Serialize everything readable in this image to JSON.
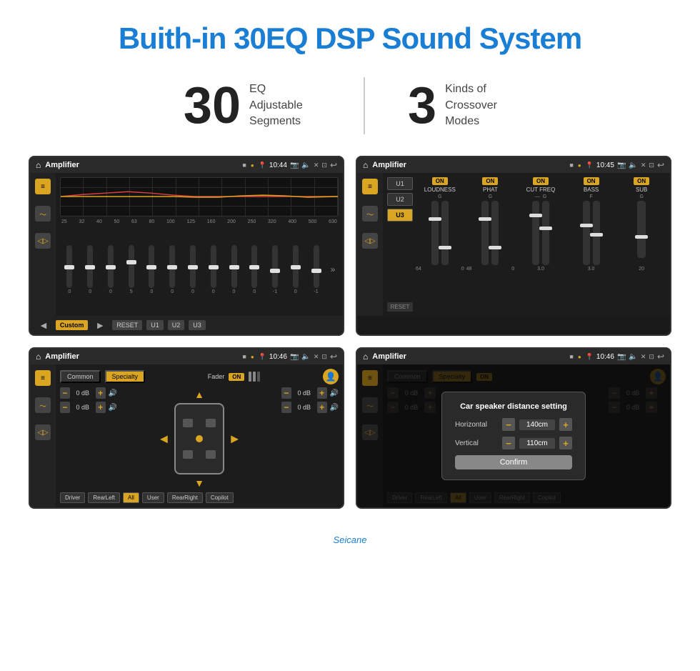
{
  "page": {
    "title": "Buith-in 30EQ DSP Sound System",
    "stat1_number": "30",
    "stat1_desc": "EQ Adjustable\nSegments",
    "stat2_number": "3",
    "stat2_desc": "Kinds of\nCrossover Modes",
    "watermark": "Seicane"
  },
  "screen1": {
    "time": "10:44",
    "title": "Amplifier",
    "freq_labels": [
      "25",
      "32",
      "40",
      "50",
      "63",
      "80",
      "100",
      "125",
      "160",
      "200",
      "250",
      "320",
      "400",
      "500",
      "630"
    ],
    "slider_values": [
      "0",
      "0",
      "0",
      "5",
      "0",
      "0",
      "0",
      "0",
      "0",
      "0",
      "-1",
      "0",
      "-1"
    ],
    "preset_label": "Custom",
    "buttons": [
      "RESET",
      "U1",
      "U2",
      "U3"
    ]
  },
  "screen2": {
    "time": "10:45",
    "title": "Amplifier",
    "presets": [
      "U1",
      "U2",
      "U3"
    ],
    "active_preset": "U3",
    "bands": [
      {
        "name": "LOUDNESS",
        "toggle": "ON",
        "label": "G"
      },
      {
        "name": "PHAT",
        "toggle": "ON",
        "label": "G"
      },
      {
        "name": "CUT FREQ",
        "toggle": "ON",
        "label": "F"
      },
      {
        "name": "BASS",
        "toggle": "ON",
        "label": "F"
      },
      {
        "name": "SUB",
        "toggle": "ON",
        "label": "G"
      }
    ],
    "reset_label": "RESET"
  },
  "screen3": {
    "time": "10:46",
    "title": "Amplifier",
    "tabs": [
      "Common",
      "Specialty"
    ],
    "active_tab": "Specialty",
    "fader_label": "Fader",
    "fader_toggle": "ON",
    "channels": [
      {
        "label": "0 dB"
      },
      {
        "label": "0 dB"
      },
      {
        "label": "0 dB"
      },
      {
        "label": "0 dB"
      }
    ],
    "bottom_btns": [
      "Driver",
      "RearLeft",
      "All",
      "User",
      "RearRight",
      "Copilot"
    ]
  },
  "screen4": {
    "time": "10:46",
    "title": "Amplifier",
    "tabs": [
      "Common",
      "Specialty"
    ],
    "active_tab": "Specialty",
    "dialog": {
      "title": "Car speaker distance setting",
      "horizontal_label": "Horizontal",
      "horizontal_value": "140cm",
      "vertical_label": "Vertical",
      "vertical_value": "110cm",
      "confirm_label": "Confirm"
    },
    "bottom_btns": [
      "Driver",
      "RearLeft",
      "All",
      "User",
      "RearRight",
      "Copilot"
    ]
  }
}
